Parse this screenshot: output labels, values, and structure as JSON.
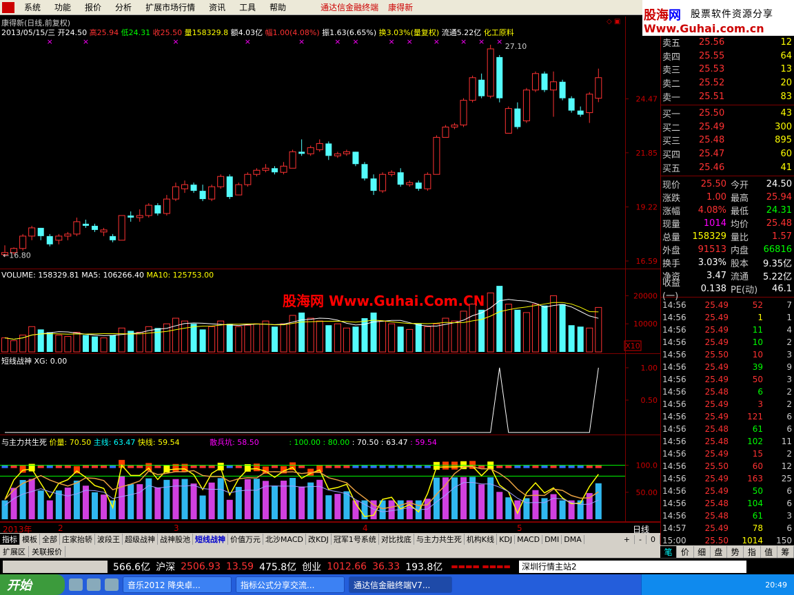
{
  "menu": {
    "items": [
      "系统",
      "功能",
      "报价",
      "分析",
      "扩展市场行情",
      "资讯",
      "工具",
      "帮助"
    ],
    "center_title": "通达信金融终端",
    "stock_name": "康得新"
  },
  "brand": {
    "name_a": "股海",
    "name_b": "网",
    "tagline": "股票软件资源分享",
    "url": "Www.Guhai.com.cn",
    "watermark": "股海网 Www.Guhai.Com.CN"
  },
  "chart_header": {
    "title": "康得新(日线,前复权)",
    "date": "2013/05/15/三",
    "open_label": "开",
    "open": "24.50",
    "high_label": "高",
    "high": "25.94",
    "low_label": "低",
    "low": "24.31",
    "close_label": "收",
    "close": "25.50",
    "vol_label": "量",
    "vol": "158329.8",
    "amt_label": "额",
    "amt": "4.03亿",
    "chg_label": "幅",
    "chg": "1.00(4.08%)",
    "amp_label": "振",
    "amp": "1.63(6.65%)",
    "turn_label": "换",
    "turn": "3.03%(量复权)",
    "float_label": "流通",
    "float": "5.22亿",
    "industry": "化工原料"
  },
  "price_axis": {
    "ticks": [
      "24.47",
      "21.85",
      "19.22",
      "16.59"
    ],
    "max_label": "27.10",
    "min_label": "←16.80"
  },
  "vol_panel": {
    "title": "VOLUME: 158329.81",
    "ma5": "MA5: 106266.40",
    "ma10": "MA10: 125753.00",
    "ticks": [
      "20000",
      "10000"
    ],
    "unit": "X10"
  },
  "dsw_panel": {
    "title": "短线战神",
    "xg": "XG: 0.00",
    "ticks": [
      "1.00",
      "0.50"
    ]
  },
  "ysz_panel": {
    "title": "与主力共生死",
    "jl": "价量: 70.50",
    "zx": "主线: 63.47",
    "kx": "快线: 59.54",
    "sbk": "散兵坑: 58.50",
    "vals": [
      ": 100.00",
      ": 80.00",
      ": 70.50",
      ": 63.47",
      ": 59.54"
    ],
    "ticks": [
      "100.0",
      "50.00"
    ]
  },
  "x_axis": {
    "labels": [
      "2013年",
      "2",
      "3",
      "4",
      "5"
    ],
    "period": "日线"
  },
  "tabs": [
    "指标",
    "模板",
    "全部",
    "庄家抬轿",
    "波段王",
    "超级战神",
    "战神股池",
    "短线战神",
    "价值万元",
    "北沙MACD",
    "改KDJ",
    "冠军1号系统",
    "对比找底",
    "与主力共生死",
    "机构K线",
    "KDJ",
    "MACD",
    "DMI",
    "DMA"
  ],
  "tab_ctrl": [
    "+",
    "-",
    "0"
  ],
  "subtabs": [
    "扩展区",
    "关联报价"
  ],
  "orderbook": {
    "sell": [
      {
        "n": "卖五",
        "p": "25.56",
        "v": "12"
      },
      {
        "n": "卖四",
        "p": "25.55",
        "v": "64"
      },
      {
        "n": "卖三",
        "p": "25.53",
        "v": "13"
      },
      {
        "n": "卖二",
        "p": "25.52",
        "v": "20"
      },
      {
        "n": "卖一",
        "p": "25.51",
        "v": "83"
      }
    ],
    "buy": [
      {
        "n": "买一",
        "p": "25.50",
        "v": "43"
      },
      {
        "n": "买二",
        "p": "25.49",
        "v": "300"
      },
      {
        "n": "买三",
        "p": "25.48",
        "v": "895"
      },
      {
        "n": "买四",
        "p": "25.47",
        "v": "60"
      },
      {
        "n": "买五",
        "p": "25.46",
        "v": "41"
      }
    ]
  },
  "stats": [
    {
      "l": "现价",
      "a": "25.50",
      "ac": "red",
      "l2": "今开",
      "b": "24.50",
      "bc": "wht"
    },
    {
      "l": "涨跌",
      "a": "1.00",
      "ac": "red",
      "l2": "最高",
      "b": "25.94",
      "bc": "red"
    },
    {
      "l": "涨幅",
      "a": "4.08%",
      "ac": "red",
      "l2": "最低",
      "b": "24.31",
      "bc": "grn"
    },
    {
      "l": "现量",
      "a": "1014",
      "ac": "mag",
      "l2": "均价",
      "b": "25.48",
      "bc": "red"
    },
    {
      "l": "总量",
      "a": "158329",
      "ac": "yel",
      "l2": "量比",
      "b": "1.57",
      "bc": "red"
    },
    {
      "l": "外盘",
      "a": "91513",
      "ac": "red",
      "l2": "内盘",
      "b": "66816",
      "bc": "grn"
    },
    {
      "l": "换手",
      "a": "3.03%",
      "ac": "wht",
      "l2": "股本",
      "b": "9.35亿",
      "bc": "wht"
    },
    {
      "l": "净资",
      "a": "3.47",
      "ac": "wht",
      "l2": "流通",
      "b": "5.22亿",
      "bc": "wht"
    },
    {
      "l": "收益(一)",
      "a": "0.138",
      "ac": "wht",
      "l2": "PE(动)",
      "b": "46.1",
      "bc": "wht"
    }
  ],
  "ticks": [
    {
      "t": "14:56",
      "p": "25.49",
      "v": "52",
      "vc": "red",
      "c": "7"
    },
    {
      "t": "14:56",
      "p": "25.49",
      "v": "1",
      "vc": "yel",
      "c": "1"
    },
    {
      "t": "14:56",
      "p": "25.49",
      "v": "11",
      "vc": "grn",
      "c": "4"
    },
    {
      "t": "14:56",
      "p": "25.49",
      "v": "10",
      "vc": "grn",
      "c": "2"
    },
    {
      "t": "14:56",
      "p": "25.50",
      "v": "10",
      "vc": "red",
      "c": "3"
    },
    {
      "t": "14:56",
      "p": "25.49",
      "v": "39",
      "vc": "grn",
      "c": "9"
    },
    {
      "t": "14:56",
      "p": "25.49",
      "v": "50",
      "vc": "red",
      "c": "3"
    },
    {
      "t": "14:56",
      "p": "25.48",
      "v": "6",
      "vc": "grn",
      "c": "2"
    },
    {
      "t": "14:56",
      "p": "25.49",
      "v": "3",
      "vc": "red",
      "c": "2"
    },
    {
      "t": "14:56",
      "p": "25.49",
      "v": "121",
      "vc": "red",
      "c": "6"
    },
    {
      "t": "14:56",
      "p": "25.48",
      "v": "61",
      "vc": "grn",
      "c": "6"
    },
    {
      "t": "14:56",
      "p": "25.48",
      "v": "102",
      "vc": "grn",
      "c": "11"
    },
    {
      "t": "14:56",
      "p": "25.49",
      "v": "15",
      "vc": "red",
      "c": "2"
    },
    {
      "t": "14:56",
      "p": "25.50",
      "v": "60",
      "vc": "red",
      "c": "12"
    },
    {
      "t": "14:56",
      "p": "25.49",
      "v": "163",
      "vc": "red",
      "c": "25"
    },
    {
      "t": "14:56",
      "p": "25.49",
      "v": "50",
      "vc": "grn",
      "c": "6"
    },
    {
      "t": "14:56",
      "p": "25.48",
      "v": "104",
      "vc": "grn",
      "c": "6"
    },
    {
      "t": "14:56",
      "p": "25.48",
      "v": "61",
      "vc": "grn",
      "c": "3"
    },
    {
      "t": "14:57",
      "p": "25.49",
      "v": "78",
      "vc": "yel",
      "c": "6"
    },
    {
      "t": "15:00",
      "p": "25.50",
      "v": "1014",
      "vc": "yel",
      "c": "150"
    }
  ],
  "rtabs": [
    "笔",
    "价",
    "细",
    "盘",
    "势",
    "指",
    "值",
    "筹"
  ],
  "status": {
    "s1": "566.6亿",
    "s2l": "沪深",
    "s2": "2506.93",
    "s3": "13.59",
    "s4": "475.8亿",
    "s5l": "创业",
    "s5": "1012.66",
    "s6": "36.33",
    "s7": "193.8亿",
    "server": "深圳行情主站2"
  },
  "taskbar": {
    "start": "开始",
    "tasks": [
      "音乐2012 降央卓...",
      "指标公式分享交流...",
      "通达信金融终端V7..."
    ],
    "clock": "20:49"
  },
  "chart_data": {
    "type": "candlestick",
    "candles": [
      [
        16.9,
        17.35,
        16.8,
        17.0
      ],
      [
        17.0,
        17.25,
        16.9,
        17.2
      ],
      [
        17.2,
        17.9,
        17.1,
        17.8
      ],
      [
        17.8,
        18.3,
        17.6,
        18.2
      ],
      [
        18.2,
        18.2,
        17.6,
        17.8
      ],
      [
        17.8,
        17.9,
        17.3,
        17.4
      ],
      [
        17.6,
        17.9,
        17.4,
        17.8
      ],
      [
        17.8,
        18.0,
        17.6,
        17.9
      ],
      [
        17.9,
        18.7,
        17.8,
        18.5
      ],
      [
        18.4,
        18.6,
        18.2,
        18.3
      ],
      [
        18.3,
        18.4,
        18.0,
        18.1
      ],
      [
        18.0,
        18.2,
        17.8,
        18.1
      ],
      [
        17.8,
        17.9,
        17.5,
        17.6
      ],
      [
        17.6,
        18.8,
        17.6,
        18.8
      ],
      [
        18.8,
        19.0,
        18.5,
        18.7
      ],
      [
        18.7,
        19.1,
        18.5,
        18.8
      ],
      [
        18.8,
        19.4,
        18.7,
        19.3
      ],
      [
        19.3,
        19.4,
        18.8,
        18.9
      ],
      [
        18.9,
        19.8,
        18.8,
        19.6
      ],
      [
        19.6,
        20.4,
        19.5,
        20.2
      ],
      [
        20.1,
        20.5,
        19.9,
        20.3
      ],
      [
        20.3,
        20.4,
        19.9,
        20.0
      ],
      [
        20.0,
        20.3,
        19.5,
        19.6
      ],
      [
        19.6,
        20.3,
        19.5,
        20.2
      ],
      [
        20.2,
        20.8,
        20.1,
        20.7
      ],
      [
        20.7,
        20.8,
        19.6,
        19.7
      ],
      [
        19.8,
        20.4,
        19.8,
        20.3
      ],
      [
        20.3,
        20.9,
        20.2,
        20.8
      ],
      [
        20.8,
        21.1,
        20.7,
        21.0
      ],
      [
        21.0,
        21.3,
        20.9,
        21.1
      ],
      [
        21.1,
        21.2,
        20.8,
        20.9
      ],
      [
        20.9,
        21.4,
        20.8,
        21.2
      ],
      [
        21.1,
        22.0,
        21.1,
        21.9
      ],
      [
        21.9,
        22.5,
        21.7,
        21.8
      ],
      [
        21.8,
        22.2,
        21.7,
        22.1
      ],
      [
        22.0,
        22.5,
        21.9,
        22.3
      ],
      [
        22.3,
        22.4,
        21.5,
        21.7
      ],
      [
        21.7,
        21.9,
        21.6,
        21.8
      ],
      [
        21.8,
        22.0,
        21.7,
        21.9
      ],
      [
        21.9,
        21.9,
        21.2,
        21.3
      ],
      [
        21.3,
        21.4,
        20.5,
        20.6
      ],
      [
        20.6,
        20.8,
        19.8,
        20.0
      ],
      [
        20.0,
        20.9,
        19.9,
        20.8
      ],
      [
        20.8,
        21.0,
        20.7,
        20.9
      ],
      [
        20.9,
        21.1,
        20.2,
        20.3
      ],
      [
        20.3,
        20.5,
        20.2,
        20.4
      ],
      [
        20.4,
        20.5,
        20.0,
        20.1
      ],
      [
        20.1,
        20.9,
        20.0,
        20.8
      ],
      [
        20.8,
        22.7,
        20.8,
        22.6
      ],
      [
        22.6,
        23.2,
        22.6,
        23.1
      ],
      [
        23.1,
        23.3,
        23.0,
        23.2
      ],
      [
        23.2,
        24.5,
        23.1,
        24.4
      ],
      [
        24.4,
        25.6,
        24.3,
        25.5
      ],
      [
        25.4,
        25.7,
        24.5,
        24.6
      ],
      [
        24.6,
        27.1,
        24.5,
        26.9
      ],
      [
        26.5,
        26.6,
        24.3,
        24.5
      ],
      [
        22.8,
        24.1,
        22.8,
        24.0
      ],
      [
        24.0,
        24.3,
        23.0,
        23.1
      ],
      [
        23.4,
        25.0,
        23.3,
        24.9
      ],
      [
        24.9,
        25.8,
        24.8,
        25.7
      ],
      [
        25.7,
        25.8,
        24.8,
        24.9
      ],
      [
        24.9,
        25.8,
        23.6,
        25.3
      ],
      [
        25.3,
        25.4,
        24.4,
        24.5
      ],
      [
        24.5,
        24.6,
        23.8,
        23.9
      ],
      [
        23.9,
        24.1,
        23.6,
        23.7
      ],
      [
        23.8,
        24.8,
        23.3,
        24.7
      ],
      [
        24.5,
        25.94,
        24.31,
        25.5
      ]
    ],
    "volume": [
      5000,
      4000,
      6000,
      9000,
      8000,
      7000,
      6000,
      5500,
      7000,
      6000,
      5500,
      5000,
      6000,
      8500,
      7500,
      7000,
      9000,
      8500,
      10000,
      12000,
      11000,
      10000,
      8000,
      9000,
      11000,
      10000,
      9000,
      9500,
      10000,
      11000,
      9000,
      10000,
      13000,
      14000,
      12000,
      11000,
      9500,
      10000,
      8500,
      9000,
      12000,
      14000,
      11000,
      10000,
      9000,
      8000,
      10000,
      9000,
      10000,
      12000,
      11000,
      14500,
      17000,
      15000,
      21000,
      23500,
      17000,
      15000,
      14000,
      17000,
      16500,
      20000,
      17000,
      9500,
      9000,
      8500,
      15833
    ],
    "price_range": [
      16.59,
      27.3
    ],
    "vol_range": [
      0,
      25000
    ],
    "xg_signals": [
      55,
      66
    ]
  }
}
